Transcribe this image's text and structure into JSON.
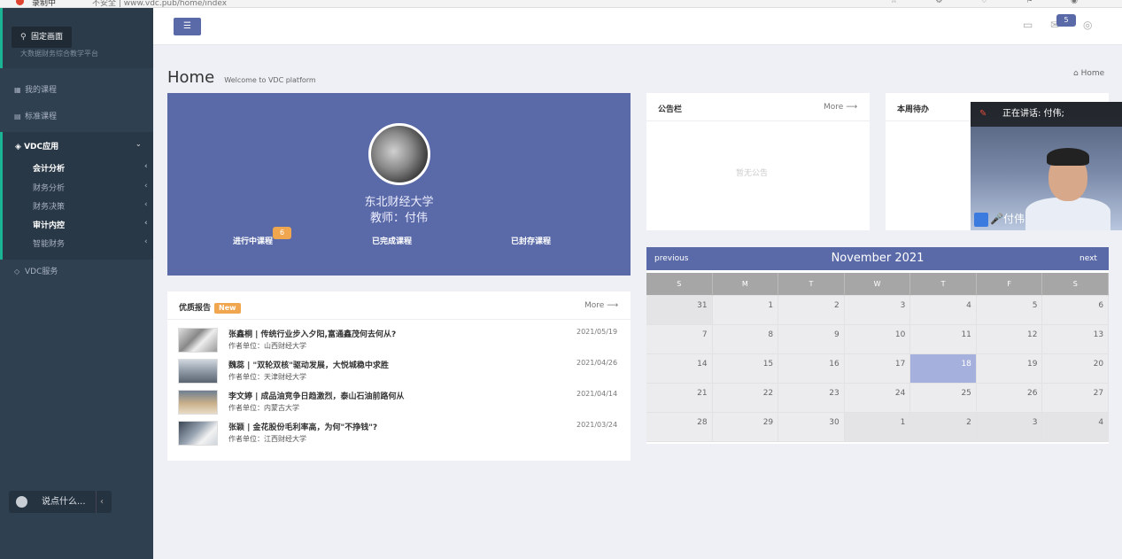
{
  "browser": {
    "recording_label": "录制中",
    "url": "不安全 | www.vdc.pub/home/index"
  },
  "sidebar": {
    "pin_tooltip": "固定画面",
    "subtitle": "大数据财务综合教学平台",
    "items": [
      {
        "label": "我的课程"
      },
      {
        "label": "标准课程"
      },
      {
        "label": "VDC应用"
      },
      {
        "label": "VDC服务"
      }
    ],
    "subitems": [
      {
        "label": "会计分析"
      },
      {
        "label": "财务分析"
      },
      {
        "label": "财务决策"
      },
      {
        "label": "审计内控"
      },
      {
        "label": "智能财务"
      }
    ],
    "chat_placeholder": "说点什么..."
  },
  "topbar": {
    "message_count": "5"
  },
  "page": {
    "title": "Home",
    "subtitle": "Welcome to VDC platform",
    "breadcrumb": "Home"
  },
  "profile": {
    "school": "东北财经大学",
    "teacher": "教师：付伟",
    "tabs": [
      {
        "label": "进行中课程",
        "badge": "6"
      },
      {
        "label": "已完成课程"
      },
      {
        "label": "已封存课程"
      }
    ]
  },
  "reports": {
    "title": "优质报告",
    "new_badge": "New",
    "more": "More",
    "items": [
      {
        "title": "张鑫桐 | 传统行业步入夕阳,富通鑫茂何去何从?",
        "org": "作者单位：山西财经大学",
        "date": "2021/05/19"
      },
      {
        "title": "魏蕊 | \"双轮双核\"驱动发展，大悦城稳中求胜",
        "org": "作者单位：天津财经大学",
        "date": "2021/04/26"
      },
      {
        "title": "李文婷 | 成品油竞争日趋激烈，泰山石油前路何从",
        "org": "作者单位：内蒙古大学",
        "date": "2021/04/14"
      },
      {
        "title": "张颖 | 金花股份毛利率高，为何\"不挣钱\"?",
        "org": "作者单位：江西财经大学",
        "date": "2021/03/24"
      }
    ]
  },
  "notice": {
    "title": "公告栏",
    "more": "More",
    "empty_text": "暂无公告"
  },
  "todo": {
    "title": "本周待办"
  },
  "calendar": {
    "prev": "previous",
    "next": "next",
    "month": "November 2021",
    "weekdays": [
      "S",
      "M",
      "T",
      "W",
      "T",
      "F",
      "S"
    ],
    "weeks": [
      [
        "31",
        "1",
        "2",
        "3",
        "4",
        "5",
        "6"
      ],
      [
        "7",
        "8",
        "9",
        "10",
        "11",
        "12",
        "13"
      ],
      [
        "14",
        "15",
        "16",
        "17",
        "18",
        "19",
        "20"
      ],
      [
        "21",
        "22",
        "23",
        "24",
        "25",
        "26",
        "27"
      ],
      [
        "28",
        "29",
        "30",
        "1",
        "2",
        "3",
        "4"
      ]
    ],
    "today": "18"
  },
  "video": {
    "speaking_label": "正在讲话: 付伟;",
    "name": "付伟"
  }
}
